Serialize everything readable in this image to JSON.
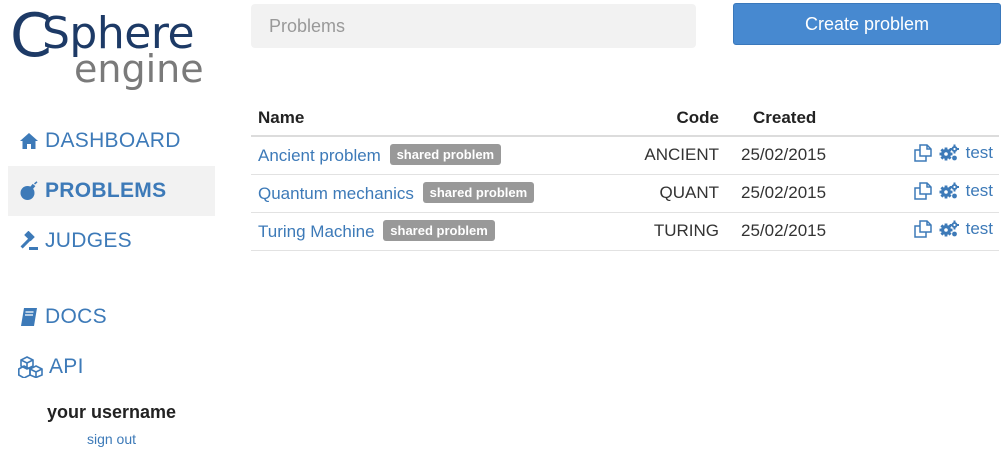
{
  "logo": {
    "c": "C",
    "sphere": "Sphere",
    "engine": "engine"
  },
  "nav": [
    {
      "id": "dashboard",
      "label": "DASHBOARD",
      "icon": "home-icon",
      "active": false
    },
    {
      "id": "problems",
      "label": "PROBLEMS",
      "icon": "bomb-icon",
      "active": true
    },
    {
      "id": "judges",
      "label": "JUDGES",
      "icon": "gavel-icon",
      "active": false
    },
    {
      "id": "docs",
      "label": "DOCS",
      "icon": "book-icon",
      "active": false
    },
    {
      "id": "api",
      "label": "API",
      "icon": "cubes-icon",
      "active": false
    }
  ],
  "user": {
    "name": "your username",
    "signout": "sign out"
  },
  "search": {
    "placeholder": "Problems"
  },
  "toolbar": {
    "create_label": "Create problem"
  },
  "table": {
    "headers": {
      "name": "Name",
      "code": "Code",
      "created": "Created"
    },
    "rows": [
      {
        "name": "Ancient problem",
        "badge": "shared problem",
        "code": "ANCIENT",
        "created": "25/02/2015",
        "action": "test"
      },
      {
        "name": "Quantum mechanics",
        "badge": "shared problem",
        "code": "QUANT",
        "created": "25/02/2015",
        "action": "test"
      },
      {
        "name": "Turing Machine",
        "badge": "shared problem",
        "code": "TURING",
        "created": "25/02/2015",
        "action": "test"
      }
    ]
  },
  "colors": {
    "brand_dark": "#1d3a66",
    "link": "#3d7ab8",
    "primary_button": "#4789d0",
    "badge": "#999999"
  }
}
